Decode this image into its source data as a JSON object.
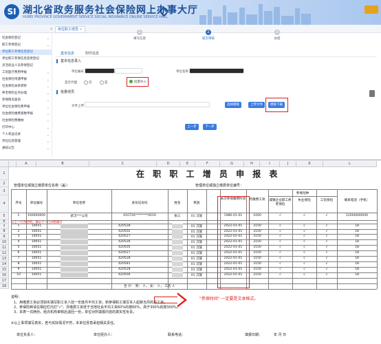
{
  "header": {
    "logo_text": "SI",
    "title": "湖北省政务服务社会保险网上办事大厅",
    "subtitle": "HUBEI PROVINCE GOVERNMENT SERVICE SOCIAL INSURANCE ONLINE SERVICE HALL"
  },
  "tabs": {
    "home_icon": "home-icon",
    "active": "单位职工增员"
  },
  "sidebar": {
    "items": [
      {
        "label": "社会保险登记",
        "active": false
      },
      {
        "label": "职工参保登记",
        "active": false
      },
      {
        "label": "单位职工参保信息登记",
        "active": true
      },
      {
        "label": "单位职工参保信息变更登记",
        "active": false
      },
      {
        "label": "灵活就业人员参保登记",
        "active": false
      },
      {
        "label": "工伤医疗费用申报",
        "active": false
      },
      {
        "label": "社会保险待遇申报",
        "active": false
      },
      {
        "label": "社会保险关系转移",
        "active": false
      },
      {
        "label": "养老保险业务办理",
        "active": false
      },
      {
        "label": "参保情况查询",
        "active": false
      },
      {
        "label": "单位社会保险费申报",
        "active": false
      },
      {
        "label": "社会保险缴费基数申报",
        "active": false
      },
      {
        "label": "社会保险费缴纳",
        "active": false
      },
      {
        "label": "打印中心",
        "active": false
      },
      {
        "label": "个人权益记录",
        "active": false
      },
      {
        "label": "单位信息管理",
        "active": false
      },
      {
        "label": "通知公告",
        "active": false
      }
    ]
  },
  "steps": [
    {
      "num": "1",
      "label": "填写信息"
    },
    {
      "num": "2",
      "label": "提交审核"
    },
    {
      "num": "3",
      "label": "办结"
    }
  ],
  "content_tabs": {
    "tab1": "基本信息",
    "tab2": "附件信息"
  },
  "form": {
    "section1": "基本信息录入",
    "unit_no_label": "单位编号",
    "unit_name_label": "单位名称",
    "agent_label": "是否代理",
    "radio_no": "否",
    "radio_yes": "是",
    "excel_checkbox": "批量导入",
    "section2": "批量增员",
    "upload_label": "文件上传",
    "btn_select": "选择模板",
    "btn_upload": "上传文件",
    "btn_download": "模板下载",
    "btn_prev": "上一步",
    "btn_next": "下一步"
  },
  "sheet": {
    "col_headers": [
      "A",
      "B",
      "C",
      "D",
      "E",
      "F",
      "G",
      "H",
      "I",
      "J",
      "K",
      "L"
    ],
    "title": "在 职 职 工 增 员 申 报 表",
    "unit_name_line": "管理单位或独立缴费单位名称（盖）：",
    "unit_no_line": "管理单位或独立缴费单位编号：",
    "h_seq": "序号",
    "h_unit_no": "单位编号",
    "h_unit_name": "单位名称",
    "h_id": "身份证号码",
    "h_name": "姓名",
    "h_ethnic": "民族",
    "h_date": "本次参保缴费时间",
    "h_wage": "月缴费工资",
    "h_ins": "参保险种",
    "h_ins1": "城镇企业职工养老保险",
    "h_ins2": "失业保险",
    "h_ins3": "工伤保险",
    "h_phone": "联系电话（手机）",
    "example_row": {
      "seq": "1",
      "unit_no": "100000000",
      "unit_name": "武汉***公司",
      "id": "010726********0019",
      "name": "张三",
      "ethnic": "01 汉族",
      "date": "1980-01-01",
      "wage": "1000",
      "check": "√",
      "phone": "12000000000"
    },
    "red_note": "以上一行为范例，请从下一行开始填写",
    "rows": [
      {
        "seq": "1",
        "unit_no": "10051",
        "id": "420528",
        "ethnic": "01 汉族",
        "date": "2022-01-01",
        "wage": "3150",
        "check": "√",
        "phone": "18"
      },
      {
        "seq": "2",
        "unit_no": "10051",
        "id": "420502",
        "ethnic": "01 汉族",
        "date": "2022-01-01",
        "wage": "3150",
        "check": "√",
        "phone": "18"
      },
      {
        "seq": "3",
        "unit_no": "10051",
        "id": "420527",
        "ethnic": "01 汉族",
        "date": "2022-01-01",
        "wage": "3150",
        "check": "√",
        "phone": "18"
      },
      {
        "seq": "4",
        "unit_no": "10051",
        "id": "420526",
        "ethnic": "01 汉族",
        "date": "2022-01-01",
        "wage": "3150",
        "check": "√",
        "phone": "18"
      },
      {
        "seq": "5",
        "unit_no": "10051",
        "id": "420505",
        "ethnic": "01 汉族",
        "date": "2022-01-01",
        "wage": "3150",
        "check": "√",
        "phone": "18"
      },
      {
        "seq": "6",
        "unit_no": "10051",
        "id": "420527",
        "ethnic": "01 汉族",
        "date": "2022-01-01",
        "wage": "3150",
        "check": "√",
        "phone": "18"
      },
      {
        "seq": "7",
        "unit_no": "10051",
        "id": "420528",
        "ethnic": "01 汉族",
        "date": "2022-01-01",
        "wage": "3150",
        "check": "√",
        "phone": "18"
      },
      {
        "seq": "8",
        "unit_no": "10051",
        "id": "420581",
        "ethnic": "01 汉族",
        "date": "2022-01-01",
        "wage": "3150",
        "check": "√",
        "phone": "18"
      },
      {
        "seq": "9",
        "unit_no": "10051",
        "id": "420528",
        "ethnic": "01 汉族",
        "date": "2022-01-01",
        "wage": "3150",
        "check": "√",
        "phone": "18"
      },
      {
        "seq": "10",
        "unit_no": "10051",
        "id": "420504",
        "ethnic": "01 汉族",
        "date": "2022-01-01",
        "wage": "3150",
        "check": "√",
        "phone": "18"
      }
    ],
    "total_row": "合  计：  男：    人，   女：    人，   工伤   人",
    "hint": "\"参保时间\" 一定要是文本格式。",
    "notes": [
      "说明：",
      "1、用缴费工资必须如实填写职工本人前一年度月平均工资，新参保职工填写本人起薪当月的月工资。",
      "2、参保险种请在相应栏内打\"√\"，月缴费工资低于当地社会平均工资60%的按60%，高于300%的按300%。",
      "3、本表一式两份，经办机构审核后退回一份，单位对所填报内容的真实性负责。"
    ],
    "footer_note": "※以上事项填写真实，若与实际情况不符，本单位愿意承担相关责任。",
    "sign_responsible": "单位负责人：",
    "sign_operator": "单位经办人：",
    "sign_phone": "联系电话：",
    "sign_date": "填报日期：",
    "sign_date_parts": "年    月    日"
  },
  "colors": {
    "accent": "#2b6cc4",
    "highlight": "#e02020",
    "redact": "#2a2a2a"
  }
}
